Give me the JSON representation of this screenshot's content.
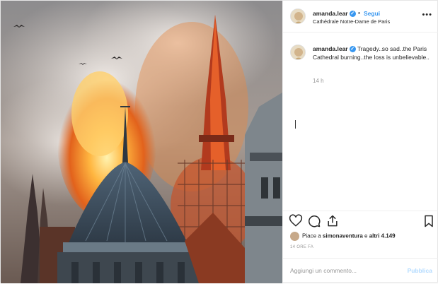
{
  "post": {
    "username": "amanda.lear",
    "follow_label": "Segui",
    "dot": "•",
    "location": "Cathédrale Notre-Dame de Paris",
    "more_label": "•••",
    "caption": "Tragedy..so sad..the Paris Cathedral burning..the loss is unbelievable..",
    "time_ago": "14 h",
    "likes_prefix": "Piace a ",
    "likes_user": "simonaventura",
    "likes_mid": " e ",
    "likes_others": "altri 4.149",
    "timestamp": "14 ORE FA",
    "comment_placeholder": "Aggiungi un commento...",
    "publish_label": "Pubblica"
  },
  "icons": [
    "heart-icon",
    "comment-icon",
    "share-icon",
    "bookmark-icon",
    "verified-icon"
  ],
  "colors": {
    "link": "#3897f0",
    "verified": "#3897f0",
    "publish_disabled": "#b3dbff",
    "muted": "#999999"
  }
}
